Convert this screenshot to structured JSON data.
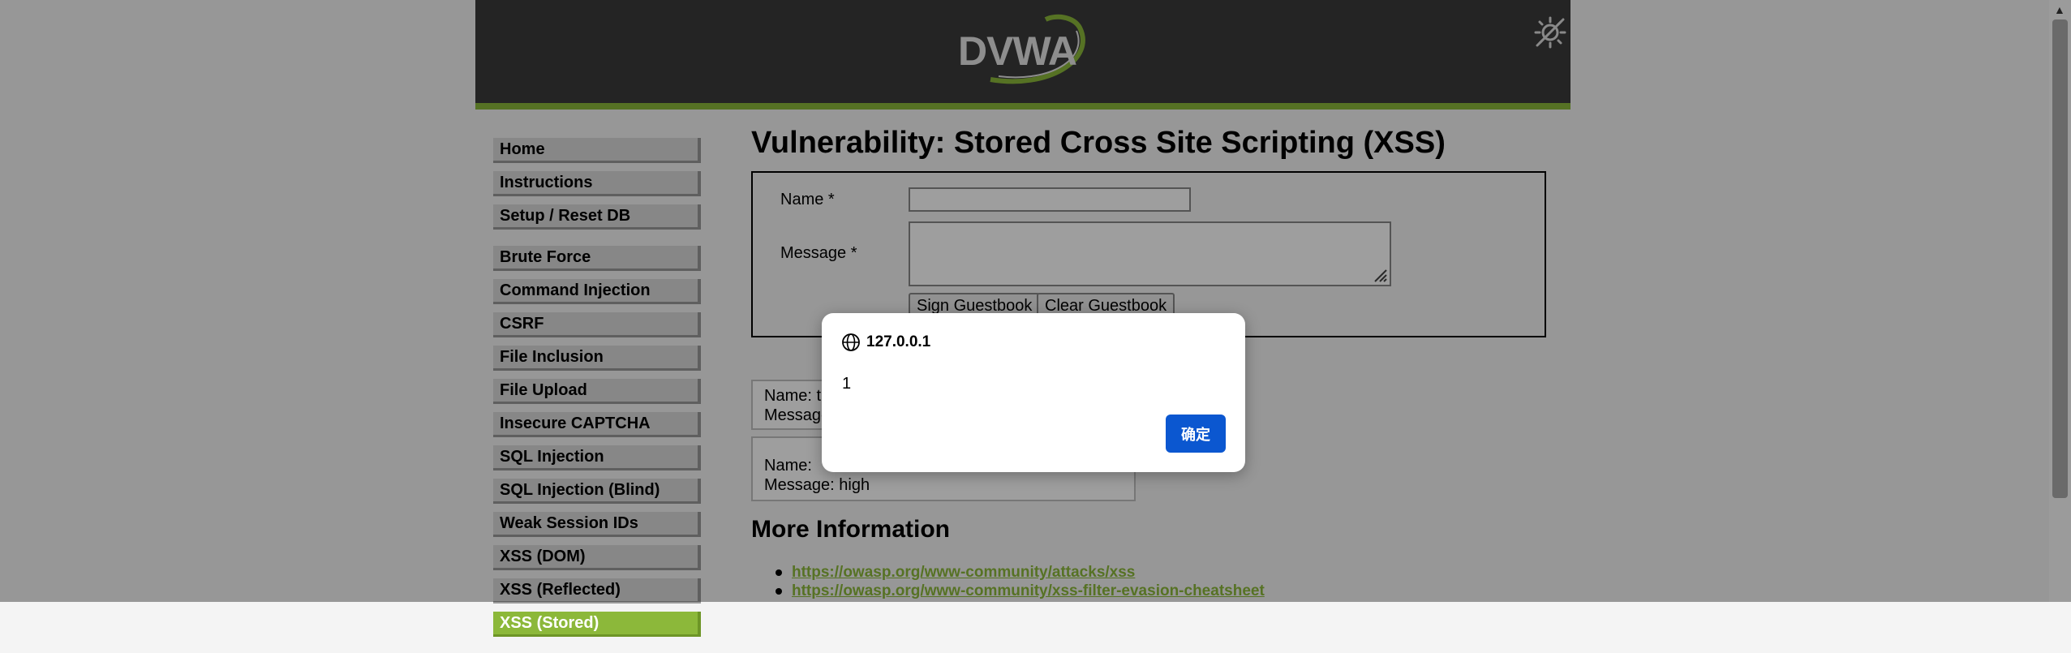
{
  "logo": {
    "text": "DVWA"
  },
  "menu": {
    "group1": [
      "Home",
      "Instructions",
      "Setup / Reset DB"
    ],
    "group2": [
      "Brute Force",
      "Command Injection",
      "CSRF",
      "File Inclusion",
      "File Upload",
      "Insecure CAPTCHA",
      "SQL Injection",
      "SQL Injection (Blind)",
      "Weak Session IDs",
      "XSS (DOM)",
      "XSS (Reflected)",
      "XSS (Stored)"
    ],
    "active": "XSS (Stored)"
  },
  "main": {
    "title": "Vulnerability: Stored Cross Site Scripting (XSS)",
    "form": {
      "name_label": "Name *",
      "message_label": "Message *",
      "name_value": "",
      "message_value": "",
      "sign_button": "Sign Guestbook",
      "clear_button": "Clear Guestbook"
    },
    "entries": [
      {
        "name_line": "Name: t",
        "message_line": "Message"
      },
      {
        "name_line": "Name:",
        "message_line": "Message: high"
      }
    ],
    "more_info_title": "More Information",
    "links": [
      "https://owasp.org/www-community/attacks/xss",
      "https://owasp.org/www-community/xss-filter-evasion-cheatsheet"
    ]
  },
  "dialog": {
    "host": "127.0.0.1",
    "message": "1",
    "ok_button": "确定"
  },
  "colors": {
    "accent": "#8cb83a",
    "header_bg": "#3a3a3a",
    "dialog_button": "#0b57d0"
  }
}
